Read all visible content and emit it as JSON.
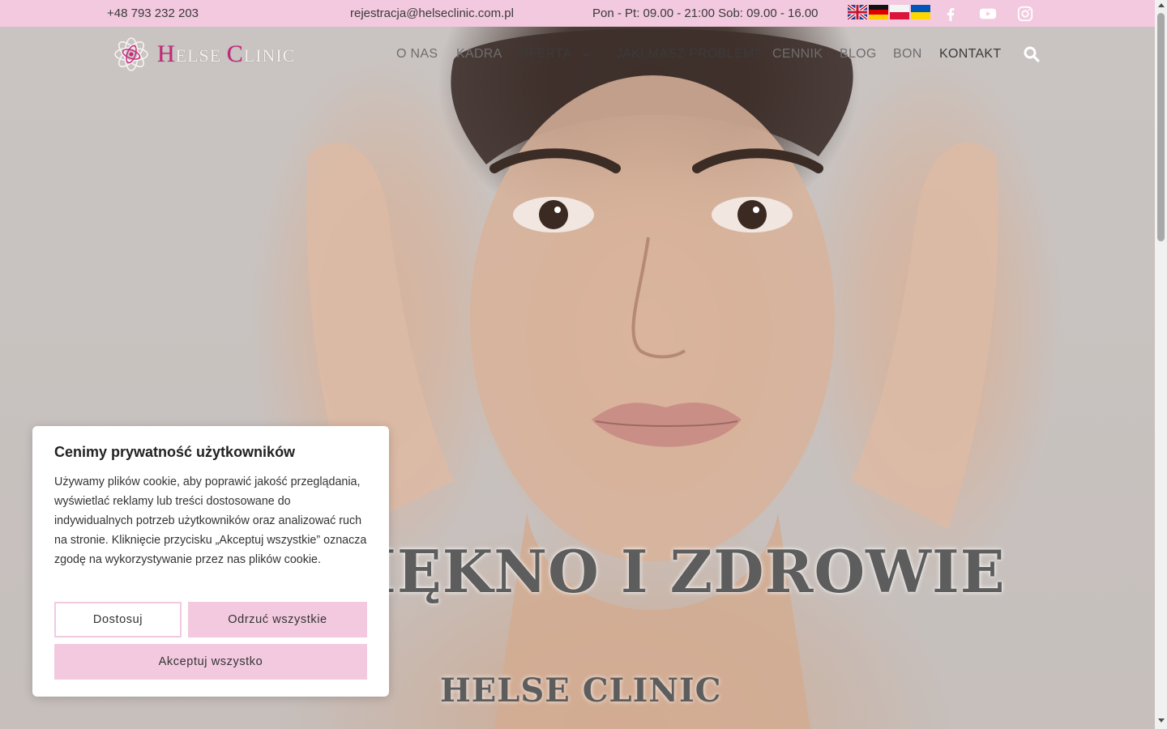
{
  "topbar": {
    "phone": "+48 793 232 203",
    "email": "rejestracja@helseclinic.com.pl",
    "hours": "Pon - Pt: 09.00 - 21:00 Sob: 09.00 - 16.00",
    "languages": [
      "English",
      "Deutsch",
      "Polski",
      "Українська"
    ],
    "social": [
      "facebook-icon",
      "youtube-icon",
      "instagram-icon"
    ],
    "background": "#f2c9df"
  },
  "header": {
    "logo": {
      "prefix_cap": "H",
      "prefix_rest": "ELSE ",
      "suffix_cap": "C",
      "suffix_rest": "LINIC",
      "accent": "#c9247d"
    },
    "nav": {
      "o_nas": "O NAS",
      "kadra": "KADRA",
      "oferta": "OFERTA",
      "problem": "JAKI MASZ PROBLEM?",
      "cennik": "CENNIK",
      "blog": "BLOG",
      "bon": "BON",
      "kontakt": "KONTAKT"
    }
  },
  "hero": {
    "title": "PIĘKNO I ZDROWIE",
    "subtitle": "HELSE CLINIC"
  },
  "cookie": {
    "title": "Cenimy prywatność użytkowników",
    "text": "Używamy plików cookie, aby poprawić jakość przeglądania, wyświetlać reklamy lub treści dostosowane do indywidualnych potrzeb użytkowników oraz analizować ruch na stronie. Kliknięcie przycisku „Akceptuj wszystkie” oznacza zgodę na wykorzystywanie przez nas plików cookie.",
    "customize": "Dostosuj",
    "reject": "Odrzuć wszystkie",
    "accept": "Akceptuj wszystko",
    "button_color": "#f2c9df"
  }
}
